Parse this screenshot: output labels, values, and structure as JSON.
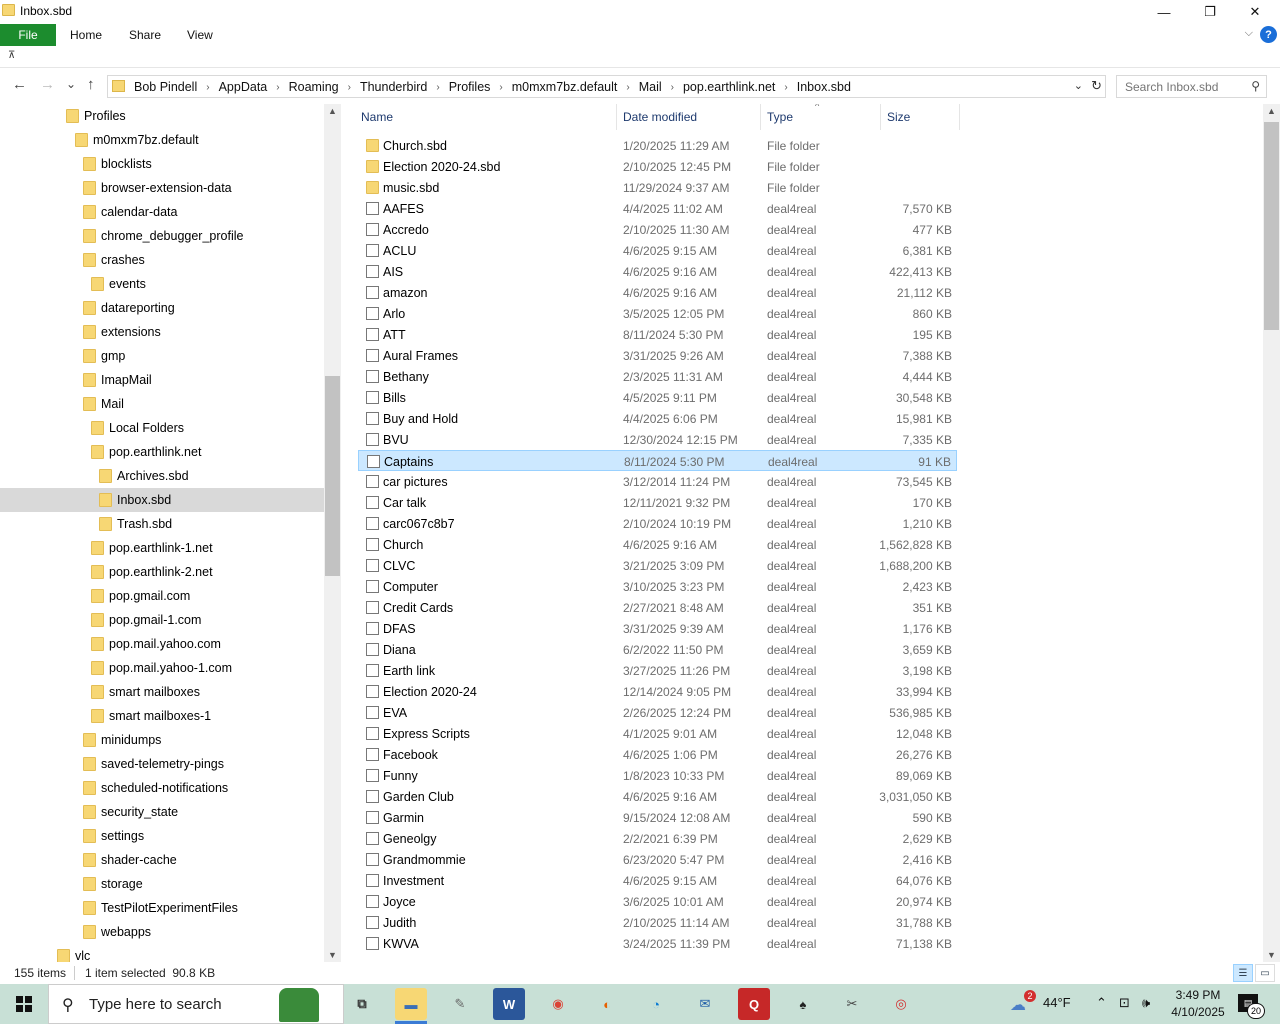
{
  "window": {
    "title": "Inbox.sbd",
    "minimize_glyph": "—",
    "maximize_glyph": "❐",
    "close_glyph": "✕"
  },
  "ribbon": {
    "tabs": [
      "File",
      "Home",
      "Share",
      "View"
    ],
    "help_glyph": "?",
    "collapse_glyph": "⌵",
    "quick_access_glyph": "⊼"
  },
  "navigation": {
    "back_glyph": "←",
    "forward_glyph": "→",
    "recent_glyph": "⌄",
    "up_glyph": "↑"
  },
  "address": {
    "crumbs": [
      "Bob Pindell",
      "AppData",
      "Roaming",
      "Thunderbird",
      "Profiles",
      "m0mxm7bz.default",
      "Mail",
      "pop.earthlink.net",
      "Inbox.sbd"
    ],
    "separator": "›",
    "dropdown_glyph": "⌄",
    "refresh_glyph": "↻"
  },
  "search": {
    "placeholder": "Search Inbox.sbd",
    "icon": "search-icon",
    "icon_glyph": "⚲"
  },
  "nav_tree": [
    {
      "label": "Profiles",
      "level": 0,
      "selected": false
    },
    {
      "label": "m0mxm7bz.default",
      "level": 1,
      "selected": false
    },
    {
      "label": "blocklists",
      "level": 2,
      "selected": false
    },
    {
      "label": "browser-extension-data",
      "level": 2,
      "selected": false
    },
    {
      "label": "calendar-data",
      "level": 2,
      "selected": false
    },
    {
      "label": "chrome_debugger_profile",
      "level": 2,
      "selected": false
    },
    {
      "label": "crashes",
      "level": 2,
      "selected": false
    },
    {
      "label": "events",
      "level": 3,
      "selected": false
    },
    {
      "label": "datareporting",
      "level": 2,
      "selected": false
    },
    {
      "label": "extensions",
      "level": 2,
      "selected": false
    },
    {
      "label": "gmp",
      "level": 2,
      "selected": false
    },
    {
      "label": "ImapMail",
      "level": 2,
      "selected": false
    },
    {
      "label": "Mail",
      "level": 2,
      "selected": false
    },
    {
      "label": "Local Folders",
      "level": 3,
      "selected": false
    },
    {
      "label": "pop.earthlink.net",
      "level": 3,
      "selected": false
    },
    {
      "label": "Archives.sbd",
      "level": 4,
      "selected": false
    },
    {
      "label": "Inbox.sbd",
      "level": 4,
      "selected": true
    },
    {
      "label": "Trash.sbd",
      "level": 4,
      "selected": false
    },
    {
      "label": "pop.earthlink-1.net",
      "level": 3,
      "selected": false
    },
    {
      "label": "pop.earthlink-2.net",
      "level": 3,
      "selected": false
    },
    {
      "label": "pop.gmail.com",
      "level": 3,
      "selected": false
    },
    {
      "label": "pop.gmail-1.com",
      "level": 3,
      "selected": false
    },
    {
      "label": "pop.mail.yahoo.com",
      "level": 3,
      "selected": false
    },
    {
      "label": "pop.mail.yahoo-1.com",
      "level": 3,
      "selected": false
    },
    {
      "label": "smart mailboxes",
      "level": 3,
      "selected": false
    },
    {
      "label": "smart mailboxes-1",
      "level": 3,
      "selected": false
    },
    {
      "label": "minidumps",
      "level": 2,
      "selected": false
    },
    {
      "label": "saved-telemetry-pings",
      "level": 2,
      "selected": false
    },
    {
      "label": "scheduled-notifications",
      "level": 2,
      "selected": false
    },
    {
      "label": "security_state",
      "level": 2,
      "selected": false
    },
    {
      "label": "settings",
      "level": 2,
      "selected": false
    },
    {
      "label": "shader-cache",
      "level": 2,
      "selected": false
    },
    {
      "label": "storage",
      "level": 2,
      "selected": false
    },
    {
      "label": "TestPilotExperimentFiles",
      "level": 2,
      "selected": false
    },
    {
      "label": "webapps",
      "level": 2,
      "selected": false
    },
    {
      "label": "vlc",
      "level": -1,
      "selected": false
    }
  ],
  "columns": {
    "name": "Name",
    "date": "Date modified",
    "type": "Type",
    "size": "Size",
    "sort_glyph": "^"
  },
  "files": [
    {
      "name": "Church.sbd",
      "date": "1/20/2025 11:29 AM",
      "type": "File folder",
      "size": "",
      "kind": "folder",
      "selected": false
    },
    {
      "name": "Election 2020-24.sbd",
      "date": "2/10/2025 12:45 PM",
      "type": "File folder",
      "size": "",
      "kind": "folder",
      "selected": false
    },
    {
      "name": "music.sbd",
      "date": "11/29/2024 9:37 AM",
      "type": "File folder",
      "size": "",
      "kind": "folder",
      "selected": false
    },
    {
      "name": "AAFES",
      "date": "4/4/2025 11:02 AM",
      "type": "deal4real",
      "size": "7,570 KB",
      "kind": "file",
      "selected": false
    },
    {
      "name": "Accredo",
      "date": "2/10/2025 11:30 AM",
      "type": "deal4real",
      "size": "477 KB",
      "kind": "file",
      "selected": false
    },
    {
      "name": "ACLU",
      "date": "4/6/2025 9:15 AM",
      "type": "deal4real",
      "size": "6,381 KB",
      "kind": "file",
      "selected": false
    },
    {
      "name": "AIS",
      "date": "4/6/2025 9:16 AM",
      "type": "deal4real",
      "size": "422,413 KB",
      "kind": "file",
      "selected": false
    },
    {
      "name": "amazon",
      "date": "4/6/2025 9:16 AM",
      "type": "deal4real",
      "size": "21,112 KB",
      "kind": "file",
      "selected": false
    },
    {
      "name": "Arlo",
      "date": "3/5/2025 12:05 PM",
      "type": "deal4real",
      "size": "860 KB",
      "kind": "file",
      "selected": false
    },
    {
      "name": "ATT",
      "date": "8/11/2024 5:30 PM",
      "type": "deal4real",
      "size": "195 KB",
      "kind": "file",
      "selected": false
    },
    {
      "name": "Aural Frames",
      "date": "3/31/2025 9:26 AM",
      "type": "deal4real",
      "size": "7,388 KB",
      "kind": "file",
      "selected": false
    },
    {
      "name": "Bethany",
      "date": "2/3/2025 11:31 AM",
      "type": "deal4real",
      "size": "4,444 KB",
      "kind": "file",
      "selected": false
    },
    {
      "name": "Bills",
      "date": "4/5/2025 9:11 PM",
      "type": "deal4real",
      "size": "30,548 KB",
      "kind": "file",
      "selected": false
    },
    {
      "name": "Buy and Hold",
      "date": "4/4/2025 6:06 PM",
      "type": "deal4real",
      "size": "15,981 KB",
      "kind": "file",
      "selected": false
    },
    {
      "name": "BVU",
      "date": "12/30/2024 12:15 PM",
      "type": "deal4real",
      "size": "7,335 KB",
      "kind": "file",
      "selected": false
    },
    {
      "name": "Captains",
      "date": "8/11/2024 5:30 PM",
      "type": "deal4real",
      "size": "91 KB",
      "kind": "file",
      "selected": true
    },
    {
      "name": "car pictures",
      "date": "3/12/2014 11:24 PM",
      "type": "deal4real",
      "size": "73,545 KB",
      "kind": "file",
      "selected": false
    },
    {
      "name": "Car talk",
      "date": "12/11/2021 9:32 PM",
      "type": "deal4real",
      "size": "170 KB",
      "kind": "file",
      "selected": false
    },
    {
      "name": "carc067c8b7",
      "date": "2/10/2024 10:19 PM",
      "type": "deal4real",
      "size": "1,210 KB",
      "kind": "file",
      "selected": false
    },
    {
      "name": "Church",
      "date": "4/6/2025 9:16 AM",
      "type": "deal4real",
      "size": "1,562,828 KB",
      "kind": "file",
      "selected": false
    },
    {
      "name": "CLVC",
      "date": "3/21/2025 3:09 PM",
      "type": "deal4real",
      "size": "1,688,200 KB",
      "kind": "file",
      "selected": false
    },
    {
      "name": "Computer",
      "date": "3/10/2025 3:23 PM",
      "type": "deal4real",
      "size": "2,423 KB",
      "kind": "file",
      "selected": false
    },
    {
      "name": "Credit Cards",
      "date": "2/27/2021 8:48 AM",
      "type": "deal4real",
      "size": "351 KB",
      "kind": "file",
      "selected": false
    },
    {
      "name": "DFAS",
      "date": "3/31/2025 9:39 AM",
      "type": "deal4real",
      "size": "1,176 KB",
      "kind": "file",
      "selected": false
    },
    {
      "name": "Diana",
      "date": "6/2/2022 11:50 PM",
      "type": "deal4real",
      "size": "3,659 KB",
      "kind": "file",
      "selected": false
    },
    {
      "name": "Earth link",
      "date": "3/27/2025 11:26 PM",
      "type": "deal4real",
      "size": "3,198 KB",
      "kind": "file",
      "selected": false
    },
    {
      "name": "Election 2020-24",
      "date": "12/14/2024 9:05 PM",
      "type": "deal4real",
      "size": "33,994 KB",
      "kind": "file",
      "selected": false
    },
    {
      "name": "EVA",
      "date": "2/26/2025 12:24 PM",
      "type": "deal4real",
      "size": "536,985 KB",
      "kind": "file",
      "selected": false
    },
    {
      "name": "Express Scripts",
      "date": "4/1/2025 9:01 AM",
      "type": "deal4real",
      "size": "12,048 KB",
      "kind": "file",
      "selected": false
    },
    {
      "name": "Facebook",
      "date": "4/6/2025 1:06 PM",
      "type": "deal4real",
      "size": "26,276 KB",
      "kind": "file",
      "selected": false
    },
    {
      "name": "Funny",
      "date": "1/8/2023 10:33 PM",
      "type": "deal4real",
      "size": "89,069 KB",
      "kind": "file",
      "selected": false
    },
    {
      "name": "Garden Club",
      "date": "4/6/2025 9:16 AM",
      "type": "deal4real",
      "size": "3,031,050 KB",
      "kind": "file",
      "selected": false
    },
    {
      "name": "Garmin",
      "date": "9/15/2024 12:08 AM",
      "type": "deal4real",
      "size": "590 KB",
      "kind": "file",
      "selected": false
    },
    {
      "name": "Geneolgy",
      "date": "2/2/2021 6:39 PM",
      "type": "deal4real",
      "size": "2,629 KB",
      "kind": "file",
      "selected": false
    },
    {
      "name": "Grandmommie",
      "date": "6/23/2020 5:47 PM",
      "type": "deal4real",
      "size": "2,416 KB",
      "kind": "file",
      "selected": false
    },
    {
      "name": "Investment",
      "date": "4/6/2025 9:15 AM",
      "type": "deal4real",
      "size": "64,076 KB",
      "kind": "file",
      "selected": false
    },
    {
      "name": "Joyce",
      "date": "3/6/2025 10:01 AM",
      "type": "deal4real",
      "size": "20,974 KB",
      "kind": "file",
      "selected": false
    },
    {
      "name": "Judith",
      "date": "2/10/2025 11:14 AM",
      "type": "deal4real",
      "size": "31,788 KB",
      "kind": "file",
      "selected": false
    },
    {
      "name": "KWVA",
      "date": "3/24/2025 11:39 PM",
      "type": "deal4real",
      "size": "71,138 KB",
      "kind": "file",
      "selected": false
    }
  ],
  "status": {
    "item_count": "155 items",
    "selection": "1 item selected  90.8 KB",
    "details_view_glyph": "☰",
    "thumbs_view_glyph": "▭"
  },
  "taskbar": {
    "search_placeholder": "Type here to search",
    "search_glyph": "⚲",
    "apps": [
      {
        "icon": "task-view-icon",
        "glyph": "⧉",
        "bg": "#c8e0d6",
        "fg": "#333",
        "active": false
      },
      {
        "icon": "file-explorer-icon",
        "glyph": "▬",
        "bg": "#f7d774",
        "fg": "#3b6fb6",
        "active": true
      },
      {
        "icon": "paint-icon",
        "glyph": "✎",
        "bg": "#c8e0d6",
        "fg": "#666",
        "active": false
      },
      {
        "icon": "word-icon",
        "glyph": "W",
        "bg": "#2b579a",
        "fg": "#fff",
        "active": false
      },
      {
        "icon": "chrome-icon",
        "glyph": "◉",
        "bg": "#c8e0d6",
        "fg": "#db4437",
        "active": false
      },
      {
        "icon": "firefox-icon",
        "glyph": "◐",
        "bg": "#c8e0d6",
        "fg": "#e66000",
        "active": false
      },
      {
        "icon": "edge-icon",
        "glyph": "◔",
        "bg": "#c8e0d6",
        "fg": "#0c7bd3",
        "active": false
      },
      {
        "icon": "mail-icon",
        "glyph": "✉",
        "bg": "#c8e0d6",
        "fg": "#1f5ea8",
        "active": false
      },
      {
        "icon": "quicken-icon",
        "glyph": "Q",
        "bg": "#c62828",
        "fg": "#fff",
        "active": false
      },
      {
        "icon": "solitaire-icon",
        "glyph": "♠",
        "bg": "#c8e0d6",
        "fg": "#222",
        "active": false
      },
      {
        "icon": "snipping-icon",
        "glyph": "✂",
        "bg": "#c8e0d6",
        "fg": "#444",
        "active": false
      },
      {
        "icon": "security-icon",
        "glyph": "◎",
        "bg": "#c8e0d6",
        "fg": "#d32f2f",
        "active": false
      }
    ],
    "weather": "44°F",
    "weather_badge": "2",
    "time": "3:49 PM",
    "date": "4/10/2025",
    "notification_count": "20",
    "tray_chevron": "⌃",
    "tray_network": "⊡",
    "tray_volume": "🕪"
  },
  "colors": {
    "file_tab": "#1c8c2e",
    "selection": "#cce8ff",
    "selection_border": "#99d1ff",
    "nav_selected": "#d9d9d9",
    "taskbar": "#c8e0d6",
    "folder": "#f7d774"
  }
}
